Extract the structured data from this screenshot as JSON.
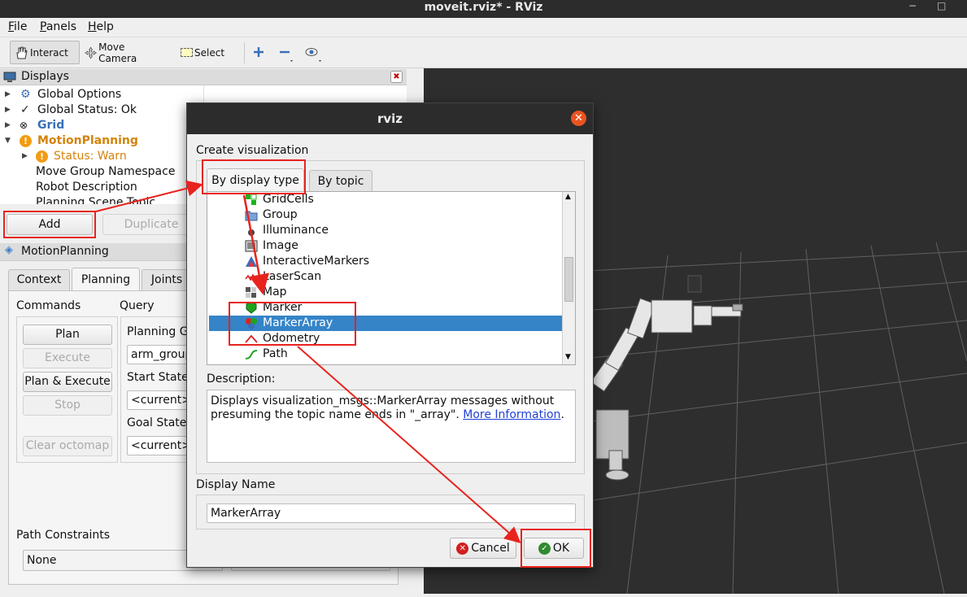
{
  "window": {
    "title": "moveit.rviz* - RViz",
    "min_glyph": "−",
    "max_glyph": "□"
  },
  "menu": {
    "items": [
      "File",
      "Panels",
      "Help"
    ]
  },
  "toolbar": {
    "interact": "Interact",
    "move_camera": "Move Camera",
    "select": "Select"
  },
  "displays": {
    "title": "Displays",
    "items": [
      {
        "label": "Global Options"
      },
      {
        "label": "Global Status: Ok"
      },
      {
        "label": "Grid"
      },
      {
        "label": "MotionPlanning"
      },
      {
        "label": "Status: Warn"
      },
      {
        "label": "Move Group Namespace"
      },
      {
        "label": "Robot Description"
      },
      {
        "label": "Planning Scene Topic"
      }
    ],
    "add": "Add",
    "duplicate": "Duplicate"
  },
  "motion_planning": {
    "title": "MotionPlanning",
    "tabs": [
      "Context",
      "Planning",
      "Joints"
    ],
    "commands_label": "Commands",
    "query_label": "Query",
    "buttons": [
      "Plan",
      "Execute",
      "Plan & Execute",
      "Stop",
      "Clear octomap"
    ],
    "planning_group_label": "Planning G",
    "planning_group_value": "arm_group",
    "start_state_label": "Start State",
    "start_state_value": "<current>",
    "goal_state_label": "Goal State:",
    "goal_state_value": "<current>",
    "path_constraints_label": "Path Constraints",
    "path_constraints_value": "None"
  },
  "dialog": {
    "title": "rviz",
    "section": "Create visualization",
    "tabs": [
      "By display type",
      "By topic"
    ],
    "list": [
      {
        "label": "GridCells",
        "icon": "gridcells-icon"
      },
      {
        "label": "Group",
        "icon": "folder-icon"
      },
      {
        "label": "Illuminance",
        "icon": "illuminance-icon"
      },
      {
        "label": "Image",
        "icon": "image-icon"
      },
      {
        "label": "InteractiveMarkers",
        "icon": "interactive-markers-icon"
      },
      {
        "label": "LaserScan",
        "icon": "laserscan-icon"
      },
      {
        "label": "Map",
        "icon": "map-icon"
      },
      {
        "label": "Marker",
        "icon": "marker-icon"
      },
      {
        "label": "MarkerArray",
        "icon": "marker-array-icon"
      },
      {
        "label": "Odometry",
        "icon": "odometry-icon"
      },
      {
        "label": "Path",
        "icon": "path-icon"
      }
    ],
    "selected": "MarkerArray",
    "description_label": "Description:",
    "description_text": "Displays visualization_msgs::MarkerArray messages without presuming the topic name ends in \"_array\". ",
    "description_link": "More Information",
    "description_end": ".",
    "display_name_label": "Display Name",
    "display_name_value": "MarkerArray",
    "cancel": "Cancel",
    "ok": "OK"
  },
  "colors": {
    "accent": "#e95420",
    "selection": "#3584c8",
    "annotation": "#e8231e",
    "warn": "#d4830a",
    "link": "#1f3fd6"
  }
}
